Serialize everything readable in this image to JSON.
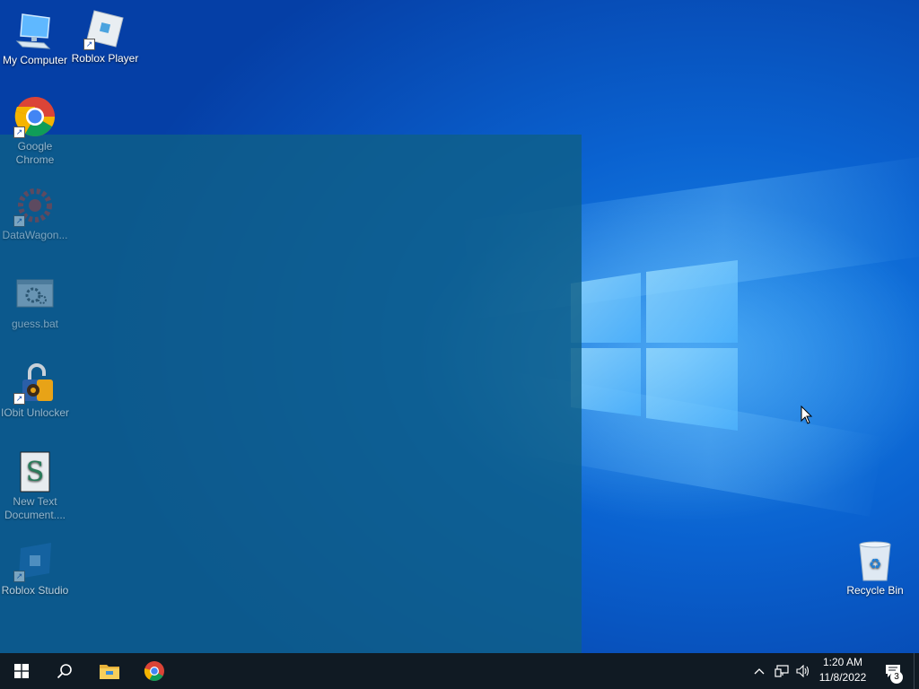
{
  "desktop": {
    "icons": [
      {
        "label": "My Computer",
        "icon": "computer-icon"
      },
      {
        "label": "Roblox Player",
        "icon": "roblox-player-icon"
      },
      {
        "label": "Google Chrome",
        "icon": "chrome-icon"
      },
      {
        "label": "DataWagon...",
        "icon": "datawagon-icon"
      },
      {
        "label": "guess.bat",
        "icon": "batch-file-icon"
      },
      {
        "label": "IObit Unlocker",
        "icon": "iobit-unlocker-icon"
      },
      {
        "label": "New Text Document....",
        "icon": "text-document-icon"
      },
      {
        "label": "Roblox Studio",
        "icon": "roblox-studio-icon"
      },
      {
        "label": "Recycle Bin",
        "icon": "recycle-bin-icon"
      }
    ]
  },
  "taskbar": {
    "start_icon": "windows-start-icon",
    "search_icon": "search-icon",
    "pinned": [
      {
        "name": "File Explorer",
        "icon": "file-explorer-icon"
      },
      {
        "name": "Google Chrome",
        "icon": "chrome-icon"
      }
    ],
    "tray": {
      "chevron_icon": "chevron-up-icon",
      "network_icon": "network-icon",
      "volume_icon": "volume-icon"
    },
    "clock": {
      "time": "1:20 AM",
      "date": "11/8/2022"
    },
    "notifications": {
      "icon": "action-center-icon",
      "count": "3"
    }
  },
  "colors": {
    "taskbar": "#101a23",
    "desktop_blue": "#0a62d0",
    "overlay": "#0f5f87"
  }
}
